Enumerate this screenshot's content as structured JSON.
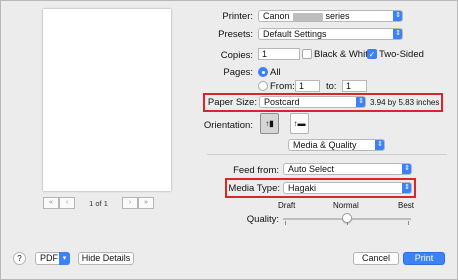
{
  "printer": {
    "label": "Printer:",
    "value_prefix": "Canon",
    "value_suffix": "series"
  },
  "presets": {
    "label": "Presets:",
    "value": "Default Settings"
  },
  "copies": {
    "label": "Copies:",
    "value": "1",
    "bw_label": "Black & White",
    "two_sided_label": "Two-Sided",
    "bw_checked": false,
    "two_sided_checked": true
  },
  "pages": {
    "label": "Pages:",
    "all_label": "All",
    "from_label": "From:",
    "from_value": "1",
    "to_label": "to:",
    "to_value": "1"
  },
  "paper_size": {
    "label": "Paper Size:",
    "value": "Postcard",
    "dimensions": "3.94 by 5.83 inches"
  },
  "orientation": {
    "label": "Orientation:",
    "portrait_glyph": "↑▮",
    "landscape_glyph": "↑▬"
  },
  "section_popup": {
    "value": "Media & Quality"
  },
  "feed_from": {
    "label": "Feed from:",
    "value": "Auto Select"
  },
  "media_type": {
    "label": "Media Type:",
    "value": "Hagaki"
  },
  "quality": {
    "label": "Quality:",
    "draft": "Draft",
    "normal": "Normal",
    "best": "Best",
    "level": "Normal"
  },
  "pager": {
    "first": "«",
    "prev": "‹",
    "text": "1 of 1",
    "next": "›",
    "last": "»"
  },
  "footer": {
    "help": "?",
    "pdf": "PDF",
    "hide_details": "Hide Details",
    "cancel": "Cancel",
    "print": "Print"
  },
  "colors": {
    "accent": "#3b82f6",
    "highlight_border": "#d9262a",
    "background": "#ececec"
  }
}
